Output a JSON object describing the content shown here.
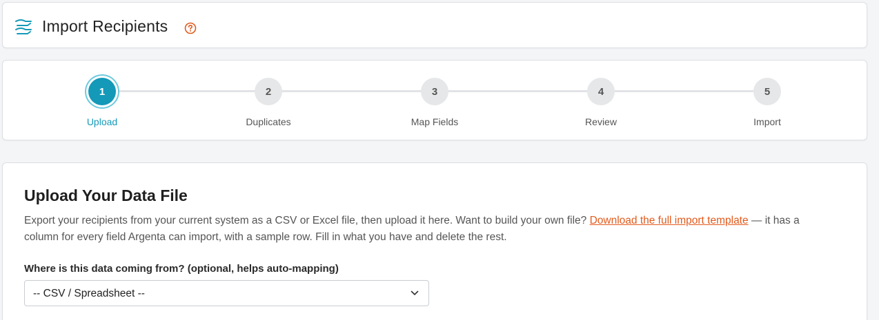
{
  "header": {
    "title": "Import Recipients",
    "icon": "import-recipients-icon",
    "help_icon": "help-circle-icon"
  },
  "stepper": {
    "active_step": 1,
    "steps": [
      {
        "number": "1",
        "label": "Upload"
      },
      {
        "number": "2",
        "label": "Duplicates"
      },
      {
        "number": "3",
        "label": "Map Fields"
      },
      {
        "number": "4",
        "label": "Review"
      },
      {
        "number": "5",
        "label": "Import"
      }
    ]
  },
  "upload": {
    "title": "Upload Your Data File",
    "description_before": "Export your recipients from your current system as a CSV or Excel file, then upload it here. Want to build your own file? ",
    "template_link": "Download the full import template",
    "description_after": " — it has a column for every field Argenta can import, with a sample row. Fill in what you have and delete the rest.",
    "source_label": "Where is this data coming from? (optional, helps auto-mapping)",
    "source_selected": "-- CSV / Spreadsheet --"
  },
  "colors": {
    "accent": "#1499b8",
    "link": "#e25a1c",
    "help_icon": "#e25a1c"
  }
}
